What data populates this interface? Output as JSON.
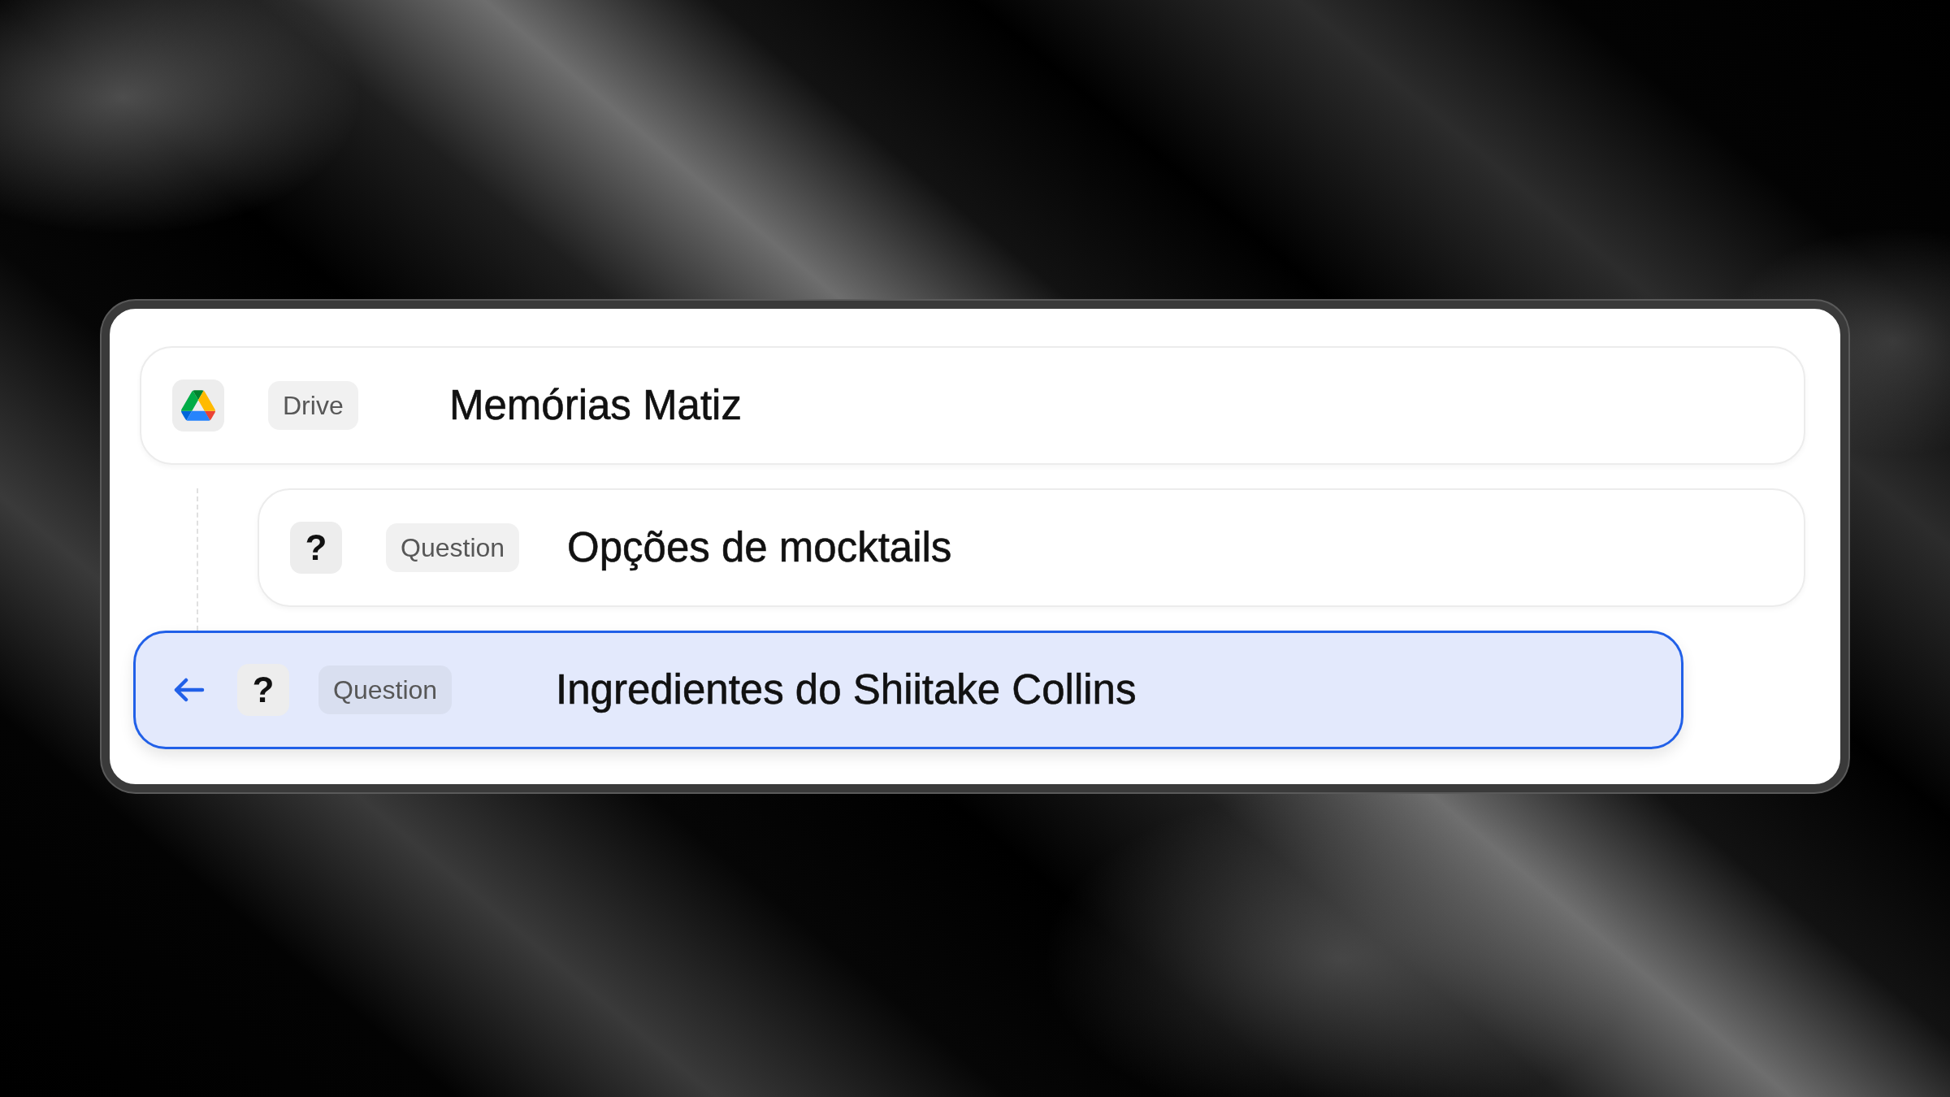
{
  "items": [
    {
      "kind": "drive",
      "tag": "Drive",
      "title": "Memórias Matiz",
      "selected": false,
      "back": false,
      "children": [
        {
          "kind": "question",
          "icon_text": "?",
          "tag": "Question",
          "title": "Opções de mocktails",
          "selected": false,
          "back": false
        }
      ]
    },
    {
      "kind": "question",
      "icon_text": "?",
      "tag": "Question",
      "title": "Ingredientes do Shiitake Collins",
      "selected": true,
      "back": true
    }
  ]
}
